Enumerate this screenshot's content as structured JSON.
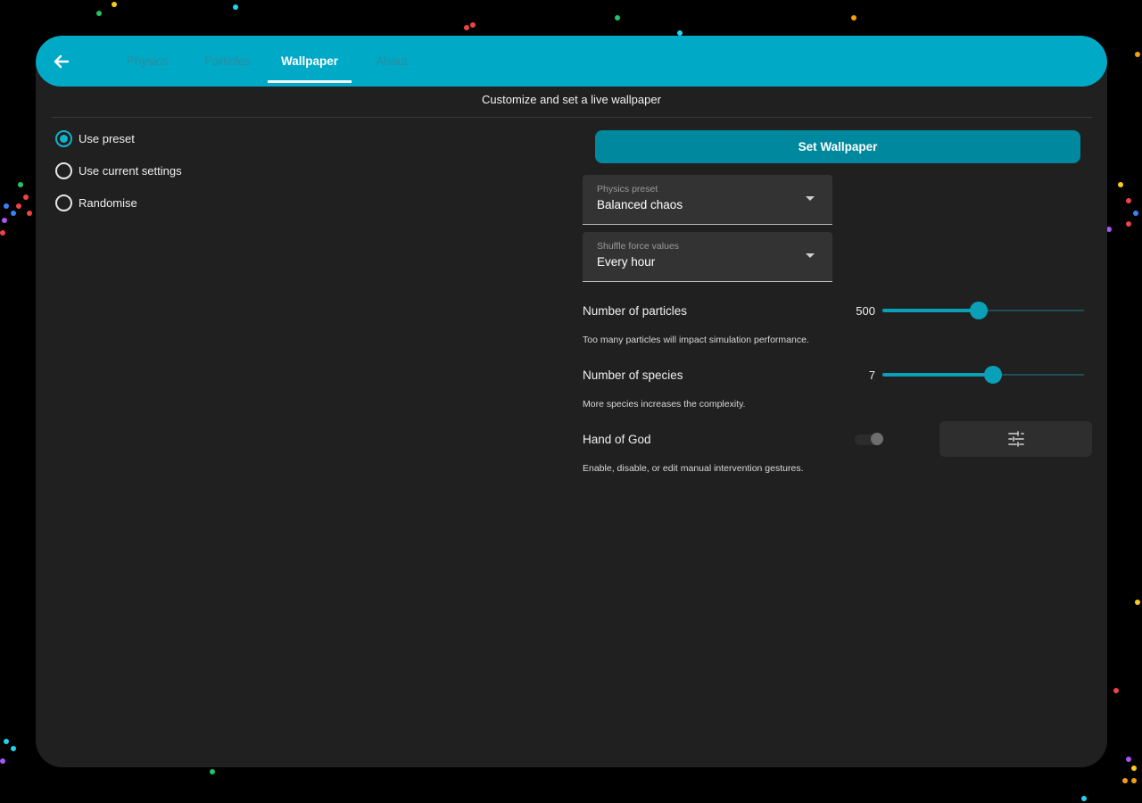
{
  "appbar": {
    "back_icon": "arrow-left-icon",
    "tabs": [
      {
        "label": "Physics",
        "active": false
      },
      {
        "label": "Particles",
        "active": false
      },
      {
        "label": "Wallpaper",
        "active": true
      },
      {
        "label": "About",
        "active": false
      }
    ]
  },
  "page": {
    "subtitle": "Customize and set a live wallpaper"
  },
  "mode_options": [
    {
      "label": "Use preset",
      "checked": true
    },
    {
      "label": "Use current settings",
      "checked": false
    },
    {
      "label": "Randomise",
      "checked": false
    }
  ],
  "set_wallpaper_label": "Set Wallpaper",
  "physics_preset": {
    "label": "Physics preset",
    "value": "Balanced chaos"
  },
  "shuffle_force": {
    "label": "Shuffle force values",
    "value": "Every hour"
  },
  "particles": {
    "label": "Number of particles",
    "value": "500",
    "fraction": 0.48,
    "help": "Too many particles will impact simulation performance."
  },
  "species": {
    "label": "Number of species",
    "value": "7",
    "fraction": 0.55,
    "help": "More species increases the complexity."
  },
  "hand_of_god": {
    "label": "Hand of God",
    "enabled": false,
    "help": "Enable, disable, or edit manual intervention gestures.",
    "edit_icon": "tune-icon"
  },
  "colors": {
    "accent": "#00a9c6",
    "button": "#00899e",
    "panel": "#202020",
    "background": "#000000"
  }
}
